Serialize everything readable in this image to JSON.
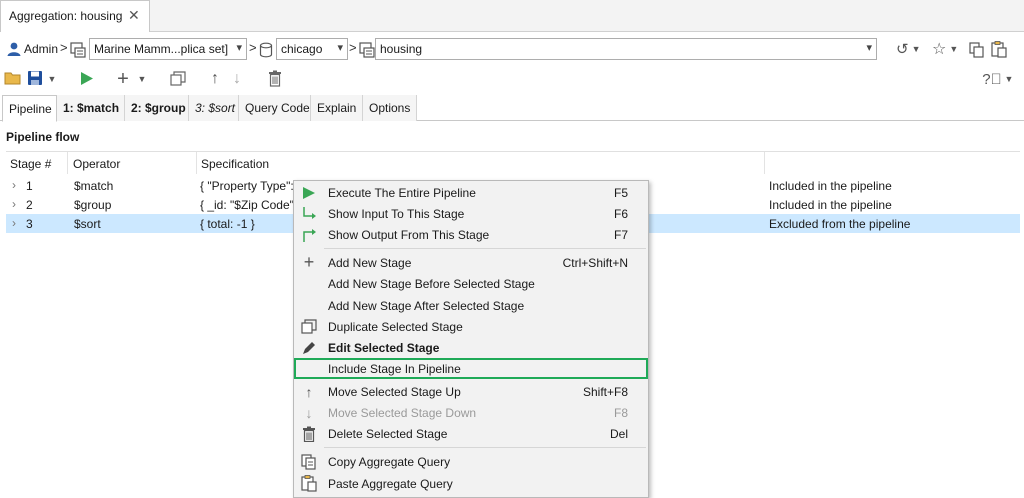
{
  "tab": {
    "title": "Aggregation: housing",
    "close": "✕"
  },
  "breadcrumb": {
    "user": "Admin",
    "connection": "Marine Mamm...plica set]",
    "database": "chicago",
    "collection": "housing"
  },
  "subtabs": [
    {
      "label": "Pipeline"
    },
    {
      "label": "1: $match"
    },
    {
      "label": "2: $group"
    },
    {
      "label": "3: $sort"
    },
    {
      "label": "Query Code"
    },
    {
      "label": "Explain"
    },
    {
      "label": "Options"
    }
  ],
  "pipeline": {
    "title": "Pipeline flow",
    "columns": [
      "Stage #",
      "Operator",
      "Specification"
    ],
    "rows": [
      {
        "stage": "1",
        "operator": "$match",
        "spec": "{ \"Property Type\": \"",
        "status": "Included in the pipeline"
      },
      {
        "stage": "2",
        "operator": "$group",
        "spec": "{ _id: \"$Zip Code\", ",
        "status": "Included in the pipeline"
      },
      {
        "stage": "3",
        "operator": "$sort",
        "spec": "{ total: -1 }",
        "status": "Excluded from the pipeline"
      }
    ]
  },
  "context_menu": {
    "items": [
      {
        "label": "Execute The Entire Pipeline",
        "shortcut": "F5",
        "icon": "play-icon"
      },
      {
        "label": "Show Input To This Stage",
        "shortcut": "F6",
        "icon": "arrow-down-right-icon"
      },
      {
        "label": "Show Output From This Stage",
        "shortcut": "F7",
        "icon": "arrow-up-right-icon"
      },
      {
        "label": "Add New Stage",
        "shortcut": "Ctrl+Shift+N",
        "icon": "plus-icon"
      },
      {
        "label": "Add New Stage Before Selected Stage",
        "shortcut": ""
      },
      {
        "label": "Add New Stage After Selected Stage",
        "shortcut": ""
      },
      {
        "label": "Duplicate Selected Stage",
        "shortcut": "",
        "icon": "duplicate-icon"
      },
      {
        "label": "Edit Selected Stage",
        "shortcut": "",
        "icon": "pen-icon"
      },
      {
        "label": "Include Stage In Pipeline",
        "shortcut": ""
      },
      {
        "label": "Move Selected Stage Up",
        "shortcut": "Shift+F8",
        "icon": "arrow-up-icon"
      },
      {
        "label": "Move Selected Stage Down",
        "shortcut": "F8",
        "icon": "arrow-down-icon"
      },
      {
        "label": "Delete Selected Stage",
        "shortcut": "Del",
        "icon": "trash-icon"
      },
      {
        "label": "Copy Aggregate Query",
        "shortcut": "",
        "icon": "copy-icon"
      },
      {
        "label": "Paste Aggregate Query",
        "shortcut": "",
        "icon": "paste-icon"
      }
    ]
  },
  "colors": {
    "selected_row": "#cce8ff",
    "highlight_border": "#1faa58",
    "play_green": "#3aa655",
    "save_blue": "#1f4e9c"
  }
}
